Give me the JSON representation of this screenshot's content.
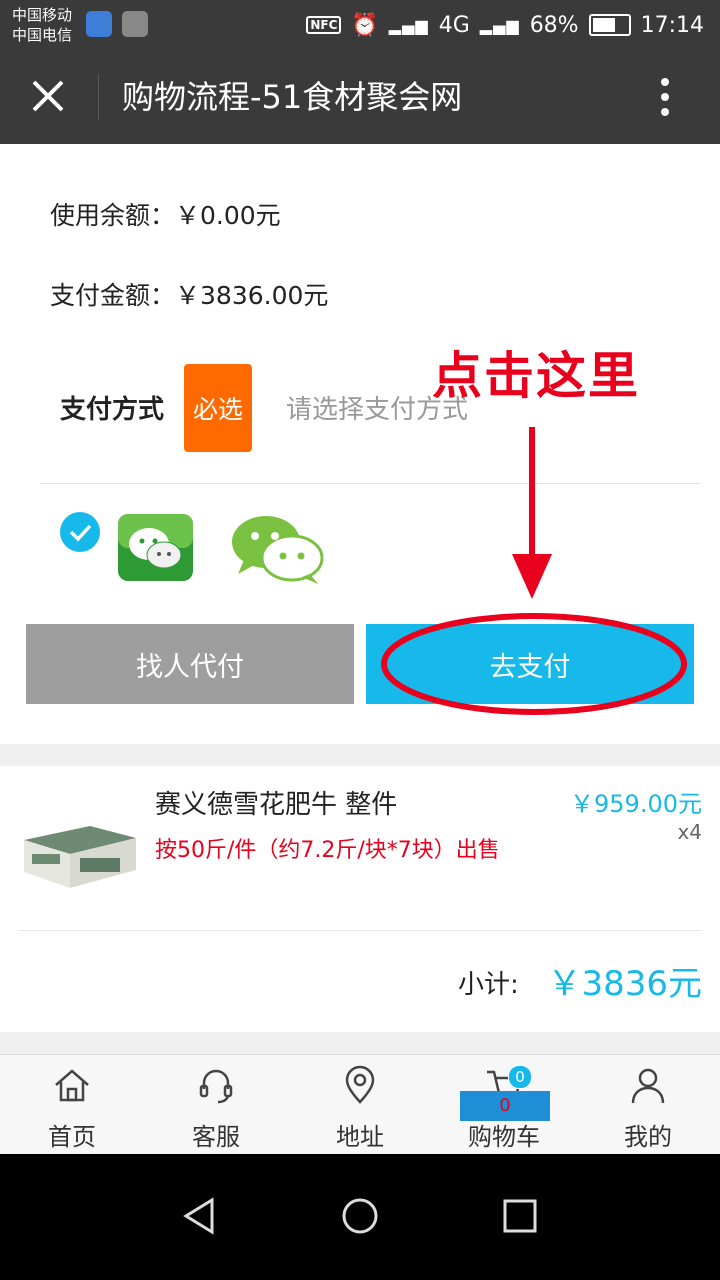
{
  "status_bar": {
    "carrier_1": "中国移动",
    "carrier_2": "中国电信",
    "nfc": "NFC",
    "network": "4G",
    "battery": "68%",
    "time": "17:14"
  },
  "title_bar": {
    "title": "购物流程-51食材聚会网"
  },
  "balance": {
    "label": "使用余额：",
    "value": "￥0.00元"
  },
  "pay_amount": {
    "label": "支付金额：",
    "value": "￥3836.00元"
  },
  "payment_method": {
    "label": "支付方式",
    "required_badge": "必选",
    "placeholder": "请选择支付方式",
    "option_selected": "wechat"
  },
  "annotation": {
    "text": "点击这里",
    "color": "#e8001c"
  },
  "buttons": {
    "friend_pay": "找人代付",
    "pay": "去支付"
  },
  "product": {
    "name": "赛义德雪花肥牛 整件",
    "desc": "按50斤/件（约7.2斤/块*7块）出售",
    "price": "￥959.00元",
    "qty": "x4"
  },
  "subtotal": {
    "label": "小计:",
    "value": "￥3836元"
  },
  "tabs": [
    {
      "label": "首页"
    },
    {
      "label": "客服"
    },
    {
      "label": "地址"
    },
    {
      "label": "购物车"
    },
    {
      "label": "我的"
    }
  ],
  "cart": {
    "badge_count": "0",
    "box_count": "0"
  },
  "colors": {
    "accent": "#17b9ea",
    "required": "#ff6a00",
    "highlight": "#e8001c"
  }
}
